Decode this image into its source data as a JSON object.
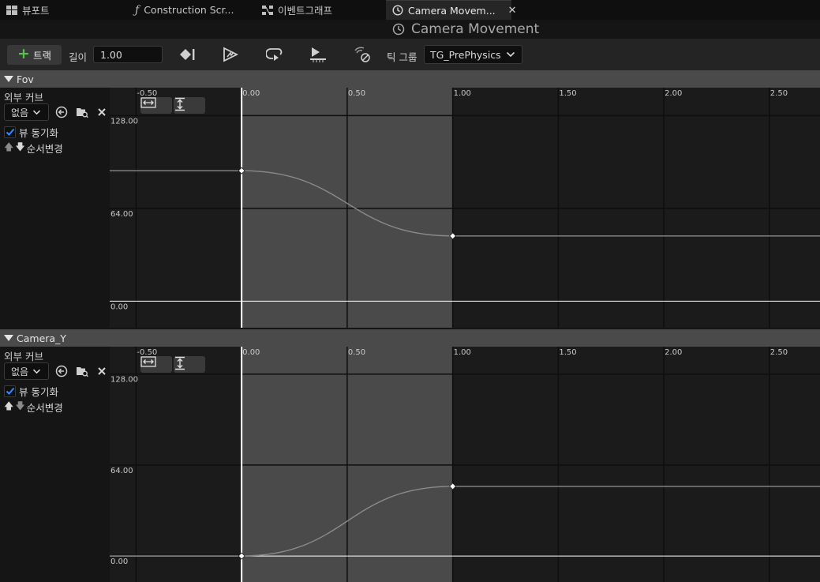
{
  "tabs": [
    {
      "label": "뷰포트",
      "icon": "viewport-grid-icon",
      "active": false
    },
    {
      "label": "Construction Scr...",
      "icon": "function-icon",
      "active": false
    },
    {
      "label": "이벤트그래프",
      "icon": "event-graph-icon",
      "active": false
    },
    {
      "label": "Camera Movem...",
      "icon": "clock-icon",
      "active": true,
      "close": "✕"
    }
  ],
  "title": "Camera Movement",
  "toolbar": {
    "add_track_label": "트랙",
    "length_label": "길이",
    "length_value": "1.00",
    "tick_group_label": "틱 그룹",
    "tick_group_value": "TG_PrePhysics"
  },
  "tracks": [
    {
      "name": "Fov",
      "external_curve_label": "외부 커브",
      "external_curve_value": "없음",
      "sync_view_label": "뷰 동기화",
      "sync_view_checked": true,
      "reorder_label": "순서변경",
      "curve": [
        {
          "t": 0.0,
          "v": 90
        },
        {
          "t": 1.0,
          "v": 45
        }
      ]
    },
    {
      "name": "Camera_Y",
      "external_curve_label": "외부 커브",
      "external_curve_value": "없음",
      "sync_view_label": "뷰 동기화",
      "sync_view_checked": true,
      "reorder_label": "순서변경",
      "curve": [
        {
          "t": 0.0,
          "v": 0
        },
        {
          "t": 1.0,
          "v": 49
        }
      ]
    }
  ],
  "graph": {
    "x_ticks": [
      "-0.50",
      "0.00",
      "0.50",
      "1.00",
      "1.50",
      "2.00",
      "2.50"
    ],
    "x_tick_values": [
      -0.5,
      0,
      0.5,
      1.0,
      1.5,
      2.0,
      2.5
    ],
    "y_ticks": [
      "128.00",
      "64.00",
      "0.00"
    ],
    "y_tick_values": [
      128,
      64,
      0
    ],
    "x_range": [
      -0.625,
      2.74
    ],
    "y_range": [
      -18.3,
      147.3
    ],
    "active_range": [
      0,
      1.0
    ]
  },
  "colors": {
    "active_region": "#4a4a4a",
    "inactive_region": "#1b1b1b",
    "grid": "#0e0e0e",
    "curve": "#8a8a8a",
    "playhead": "#ffffff"
  }
}
